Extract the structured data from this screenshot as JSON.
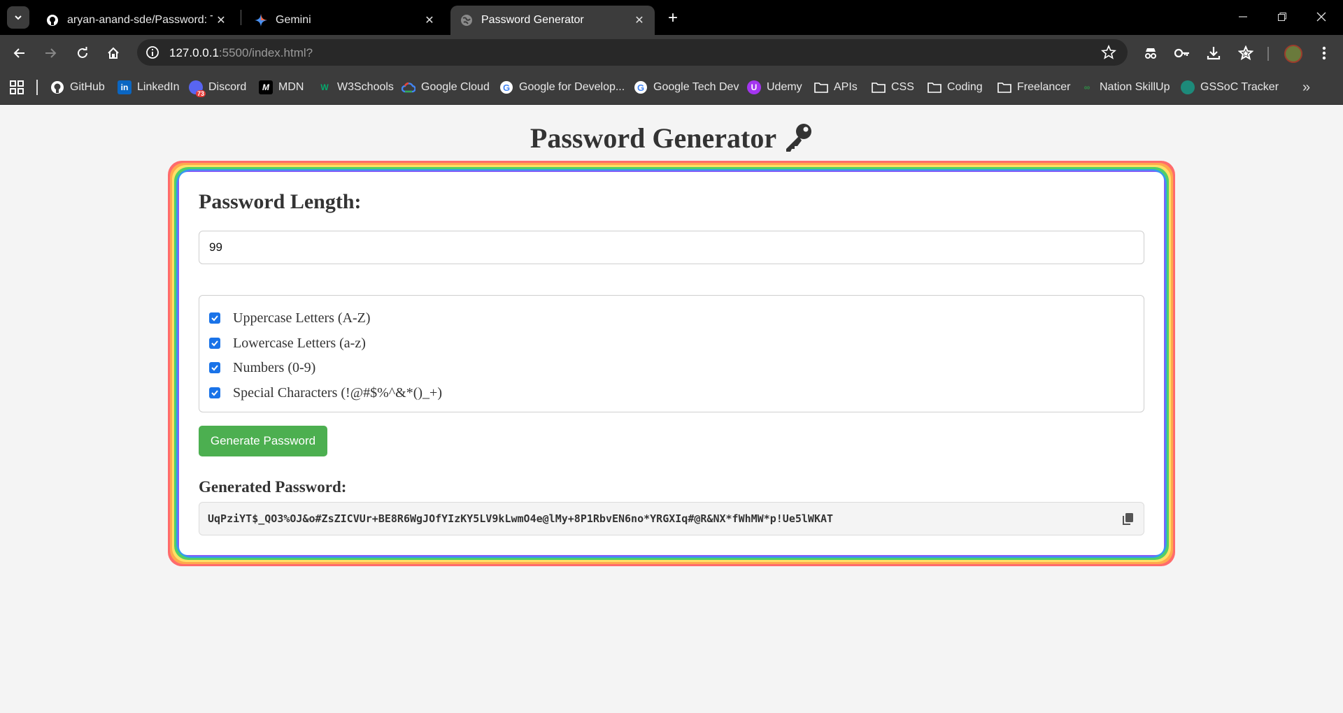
{
  "browser": {
    "tabs": [
      {
        "label": "aryan-anand-sde/Password: Thi",
        "icon": "github-icon",
        "active": false
      },
      {
        "label": "Gemini",
        "icon": "gemini-icon",
        "active": false
      },
      {
        "label": "Password Generator",
        "icon": "globe-icon",
        "active": true
      }
    ],
    "url_host": "127.0.0.1",
    "url_rest": ":5500/index.html?",
    "bookmarks": [
      {
        "label": "GitHub",
        "icon": "github-icon"
      },
      {
        "label": "LinkedIn",
        "icon": "linkedin-icon"
      },
      {
        "label": "Discord",
        "icon": "discord-icon"
      },
      {
        "label": "MDN",
        "icon": "mdn-icon"
      },
      {
        "label": "W3Schools",
        "icon": "w3schools-icon"
      },
      {
        "label": "Google Cloud",
        "icon": "google-cloud-icon"
      },
      {
        "label": "Google for Develop...",
        "icon": "google-icon"
      },
      {
        "label": "Google Tech Dev",
        "icon": "google-icon"
      },
      {
        "label": "Udemy",
        "icon": "udemy-icon"
      },
      {
        "label": "APIs",
        "icon": "folder-icon"
      },
      {
        "label": "CSS",
        "icon": "folder-icon"
      },
      {
        "label": "Coding",
        "icon": "folder-icon"
      },
      {
        "label": "Freelancer",
        "icon": "folder-icon"
      },
      {
        "label": "Nation SkillUp",
        "icon": "geeksforgeeks-icon"
      },
      {
        "label": "GSSoC Tracker",
        "icon": "gssoc-icon"
      }
    ],
    "discord_badge": "73"
  },
  "page": {
    "title": "Password Generator",
    "length_heading": "Password Length:",
    "length_value": "99",
    "options": [
      {
        "label": "Uppercase Letters (A-Z)",
        "checked": true
      },
      {
        "label": "Lowercase Letters (a-z)",
        "checked": true
      },
      {
        "label": "Numbers (0-9)",
        "checked": true
      },
      {
        "label": "Special Characters (!@#$%^&*()_+)",
        "checked": true
      }
    ],
    "generate_label": "Generate Password",
    "generated_heading": "Generated Password:",
    "generated_password": "UqPziYT$_QO3%OJ&o#ZsZICVUr+BE8R6WgJOfYIzKY5LV9kLwmO4e@lMy+8P1RbvEN6no*YRGXIq#@R&NX*fWhMW*p!Ue5lWKAT"
  },
  "colors": {
    "accent_green": "#4caf50",
    "checkbox_blue": "#1a73e8",
    "rainbow": [
      "#ff6b6b",
      "#ffa94d",
      "#ffe066",
      "#51cf66",
      "#339af0",
      "#845ef7"
    ]
  }
}
